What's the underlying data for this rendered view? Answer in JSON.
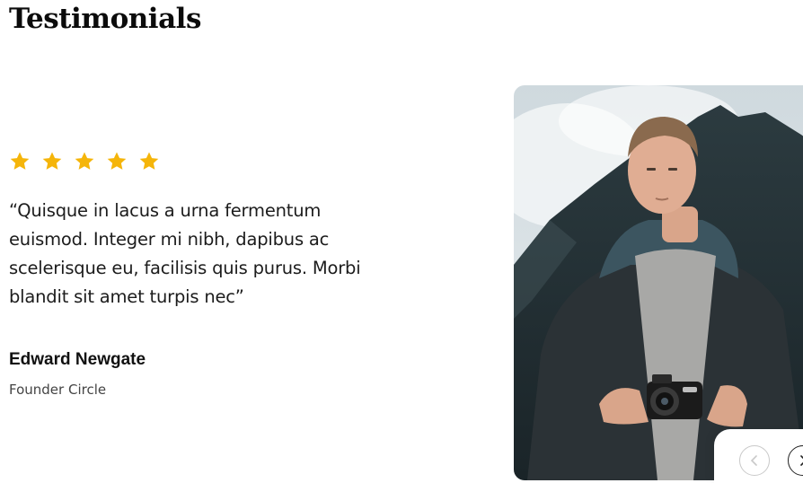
{
  "section": {
    "title": "Testimonials"
  },
  "testimonial": {
    "rating": 5,
    "rating_max": 5,
    "star_color": "#F5B50A",
    "quote": "“Quisque in lacus a urna fermentum euismod. Integer mi nibh, dapibus ac scelerisque eu, facilisis quis purus. Morbi blandit sit amet turpis nec”",
    "author_name": "Edward Newgate",
    "author_role": "Founder Circle"
  },
  "photo": {
    "subject": "man-with-camera-portrait"
  },
  "controls": {
    "prev_icon": "chevron-left-icon",
    "next_icon": "chevron-right-icon"
  }
}
